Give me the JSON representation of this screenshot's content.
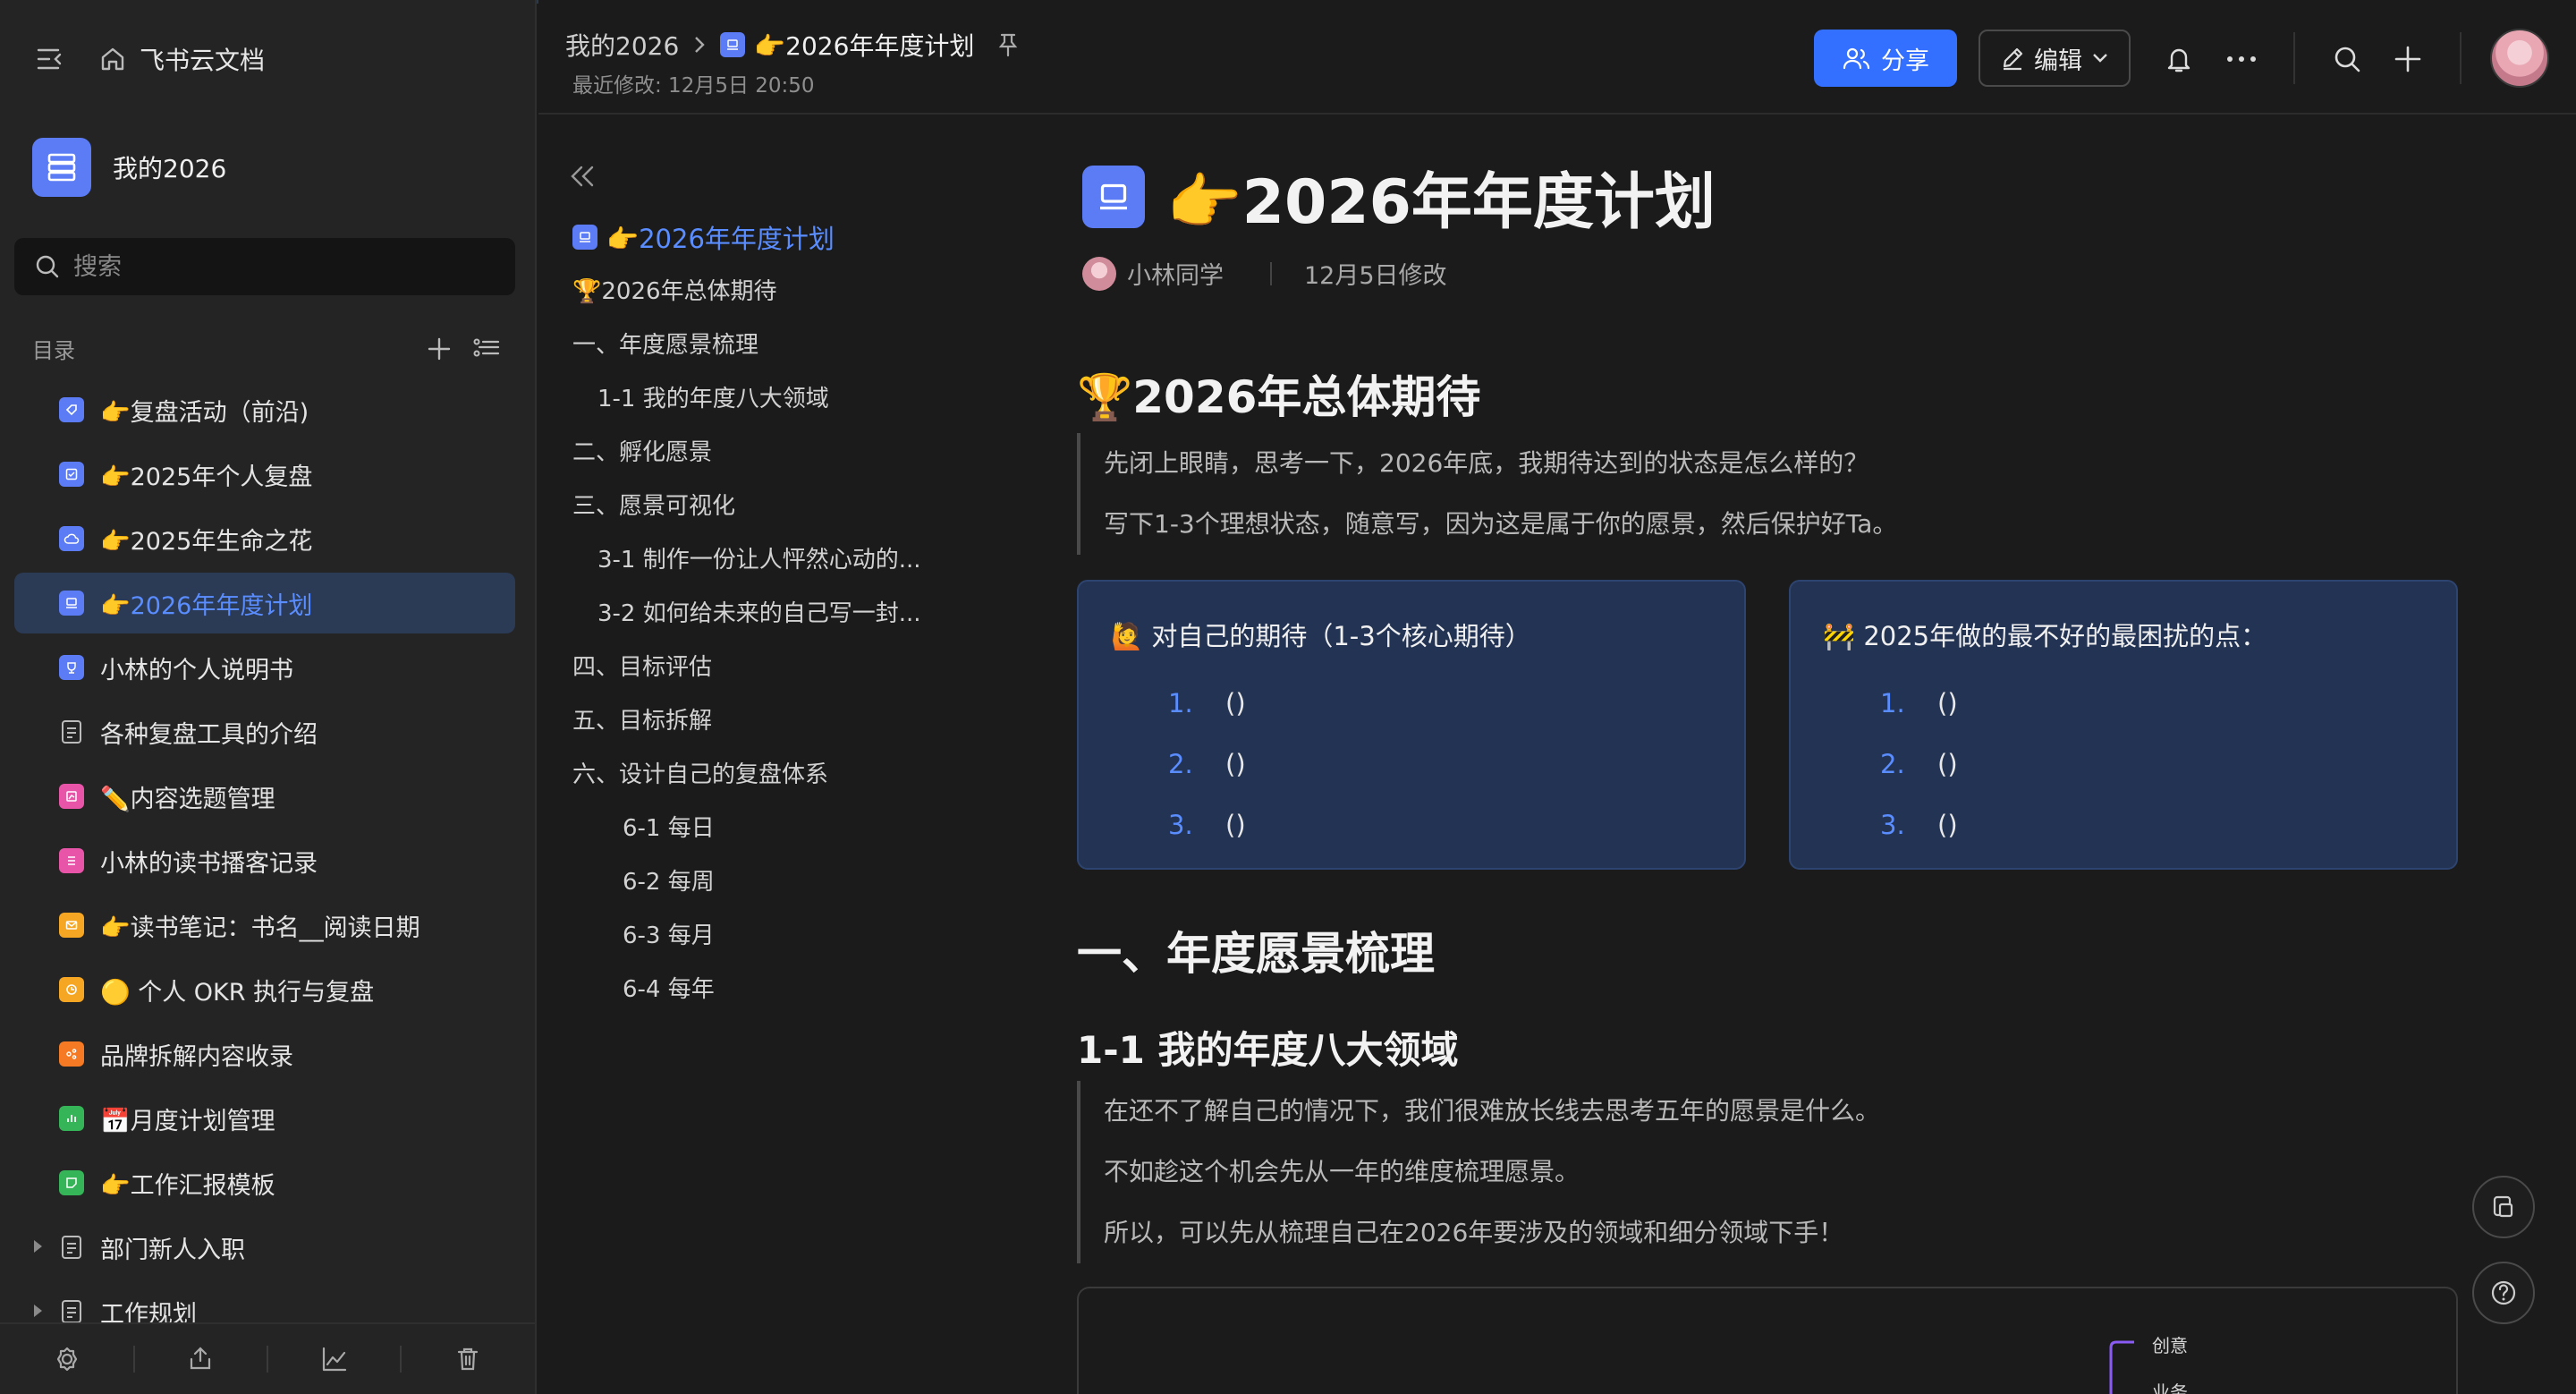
{
  "sidebar": {
    "brand": "飞书云文档",
    "space_name": "我的2026",
    "search_placeholder": "搜索",
    "toc_label": "目录",
    "items": [
      {
        "label": "👉复盘活动（前沿)",
        "color": "#5b7cf5"
      },
      {
        "label": "👉2025年个人复盘",
        "color": "#5b7cf5"
      },
      {
        "label": "👉2025年生命之花",
        "color": "#5b7cf5"
      },
      {
        "label": "👉2026年年度计划",
        "color": "#5b7cf5",
        "active": true
      },
      {
        "label": "小林的个人说明书",
        "color": "#5b7cf5"
      },
      {
        "label": "各种复盘工具的介绍",
        "color": "none"
      },
      {
        "label": "✏️内容选题管理",
        "color": "#e855a8"
      },
      {
        "label": "小林的读书播客记录",
        "color": "#e855a8"
      },
      {
        "label": "👉读书笔记：书名__阅读日期",
        "color": "#f5a623"
      },
      {
        "label": "🟡 个人 OKR 执行与复盘",
        "color": "#f5a623"
      },
      {
        "label": "品牌拆解内容收录",
        "color": "#f57a23"
      },
      {
        "label": "📅月度计划管理",
        "color": "#35b558"
      },
      {
        "label": "👉工作汇报模板",
        "color": "#35b558"
      },
      {
        "label": "部门新人入职",
        "color": "none"
      },
      {
        "label": "工作规划",
        "color": "none"
      }
    ]
  },
  "topbar": {
    "breadcrumb_root": "我的2026",
    "breadcrumb_doc": "👉2026年年度计划",
    "modified": "最近修改: 12月5日 20:50",
    "share_label": "分享",
    "edit_label": "编辑"
  },
  "outline": {
    "items": [
      {
        "label": "👉2026年年度计划",
        "level": 0,
        "active": true
      },
      {
        "label": "🏆2026年总体期待",
        "level": 0
      },
      {
        "label": "一、年度愿景梳理",
        "level": 0
      },
      {
        "label": "1-1 我的年度八大领域",
        "level": 1
      },
      {
        "label": "二、孵化愿景",
        "level": 0
      },
      {
        "label": "三、愿景可视化",
        "level": 0
      },
      {
        "label": "3-1 制作一份让人怦然心动的...",
        "level": 1
      },
      {
        "label": "3-2 如何给未来的自己写一封...",
        "level": 1
      },
      {
        "label": "四、目标评估",
        "level": 0
      },
      {
        "label": "五、目标拆解",
        "level": 0
      },
      {
        "label": "六、设计自己的复盘体系",
        "level": 0
      },
      {
        "label": "6-1 每日",
        "level": 2
      },
      {
        "label": "6-2 每周",
        "level": 2
      },
      {
        "label": "6-3 每月",
        "level": 2
      },
      {
        "label": "6-4 每年",
        "level": 2
      }
    ]
  },
  "doc": {
    "title": "👉2026年年度计划",
    "author": "小林同学",
    "modified": "12月5日修改",
    "section1_title": "🏆2026年总体期待",
    "section1_quote": [
      "先闭上眼睛，思考一下，2026年底，我期待达到的状态是怎么样的？",
      "写下1-3个理想状态，随意写，因为这是属于你的愿景，然后保护好Ta。"
    ],
    "card_left": {
      "title": "🙋 对自己的期待（1-3个核心期待）",
      "items": [
        {
          "num": "1.",
          "text": "()"
        },
        {
          "num": "2.",
          "text": "()"
        },
        {
          "num": "3.",
          "text": "()"
        }
      ]
    },
    "card_right": {
      "title": "🚧 2025年做的最不好的最困扰的点：",
      "items": [
        {
          "num": "1.",
          "text": "()"
        },
        {
          "num": "2.",
          "text": "()"
        },
        {
          "num": "3.",
          "text": "()"
        }
      ]
    },
    "section2_title": "一、年度愿景梳理",
    "section2_sub": "1-1 我的年度八大领域",
    "section2_quote": [
      "在还不了解自己的情况下，我们很难放长线去思考五年的愿景是什么。",
      "不如趁这个机会先从一年的维度梳理愿景。",
      "所以，可以先从梳理自己在2026年要涉及的领域和细分领域下手！"
    ],
    "board_label_1": "创意",
    "board_label_2": "业务"
  },
  "colors": {
    "accent": "#3370ff",
    "link": "#5a8dff",
    "card_bg": "#233353"
  }
}
